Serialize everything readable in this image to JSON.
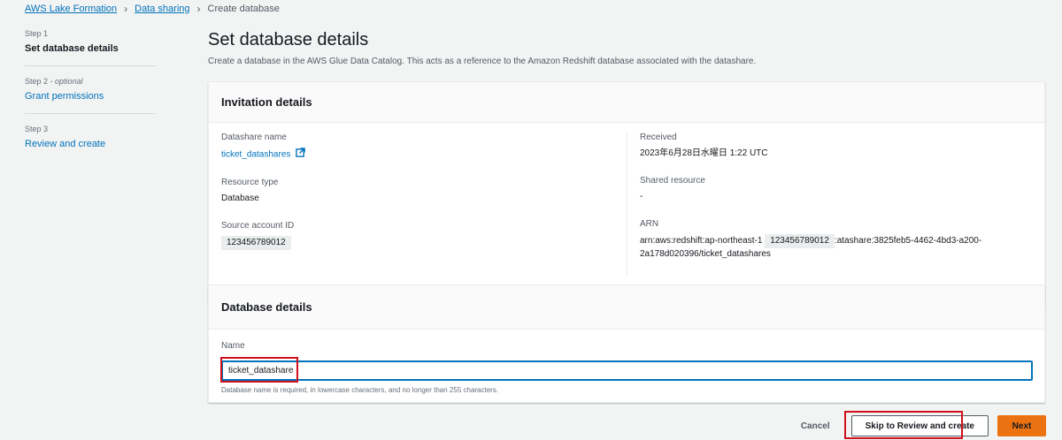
{
  "breadcrumb": {
    "items": [
      "AWS Lake Formation",
      "Data sharing"
    ],
    "current": "Create database"
  },
  "steps": [
    {
      "num": "Step 1",
      "optional": "",
      "title": "Set database details"
    },
    {
      "num": "Step 2 - ",
      "optional": "optional",
      "title": "Grant permissions"
    },
    {
      "num": "Step 3",
      "optional": "",
      "title": "Review and create"
    }
  ],
  "page": {
    "title": "Set database details",
    "subtitle": "Create a database in the AWS Glue Data Catalog. This acts as a reference to the Amazon Redshift database associated with the datashare."
  },
  "invitation": {
    "heading": "Invitation details",
    "datashare_name_label": "Datashare name",
    "datashare_name": "ticket_datashares",
    "resource_type_label": "Resource type",
    "resource_type": "Database",
    "source_account_label": "Source account ID",
    "source_account": "123456789012",
    "received_label": "Received",
    "received": "2023年6月28日水曜日 1:22 UTC",
    "shared_resource_label": "Shared resource",
    "shared_resource": "-",
    "arn_label": "ARN",
    "arn_prefix": "arn:aws:redshift:ap-northeast-1",
    "arn_account": "123456789012",
    "arn_suffix": ":atashare:3825feb5-4462-4bd3-a200-",
    "arn_line2": "2a178d020396/ticket_datashares"
  },
  "database": {
    "heading": "Database details",
    "name_label": "Name",
    "name_value": "ticket_datashare",
    "hint": "Database name is required, in lowercase characters, and no longer than 255 characters."
  },
  "actions": {
    "cancel": "Cancel",
    "skip": "Skip to Review and create",
    "next": "Next"
  },
  "colors": {
    "link": "#0073bb",
    "primary": "#ec7211",
    "highlight": "#d0101a"
  }
}
